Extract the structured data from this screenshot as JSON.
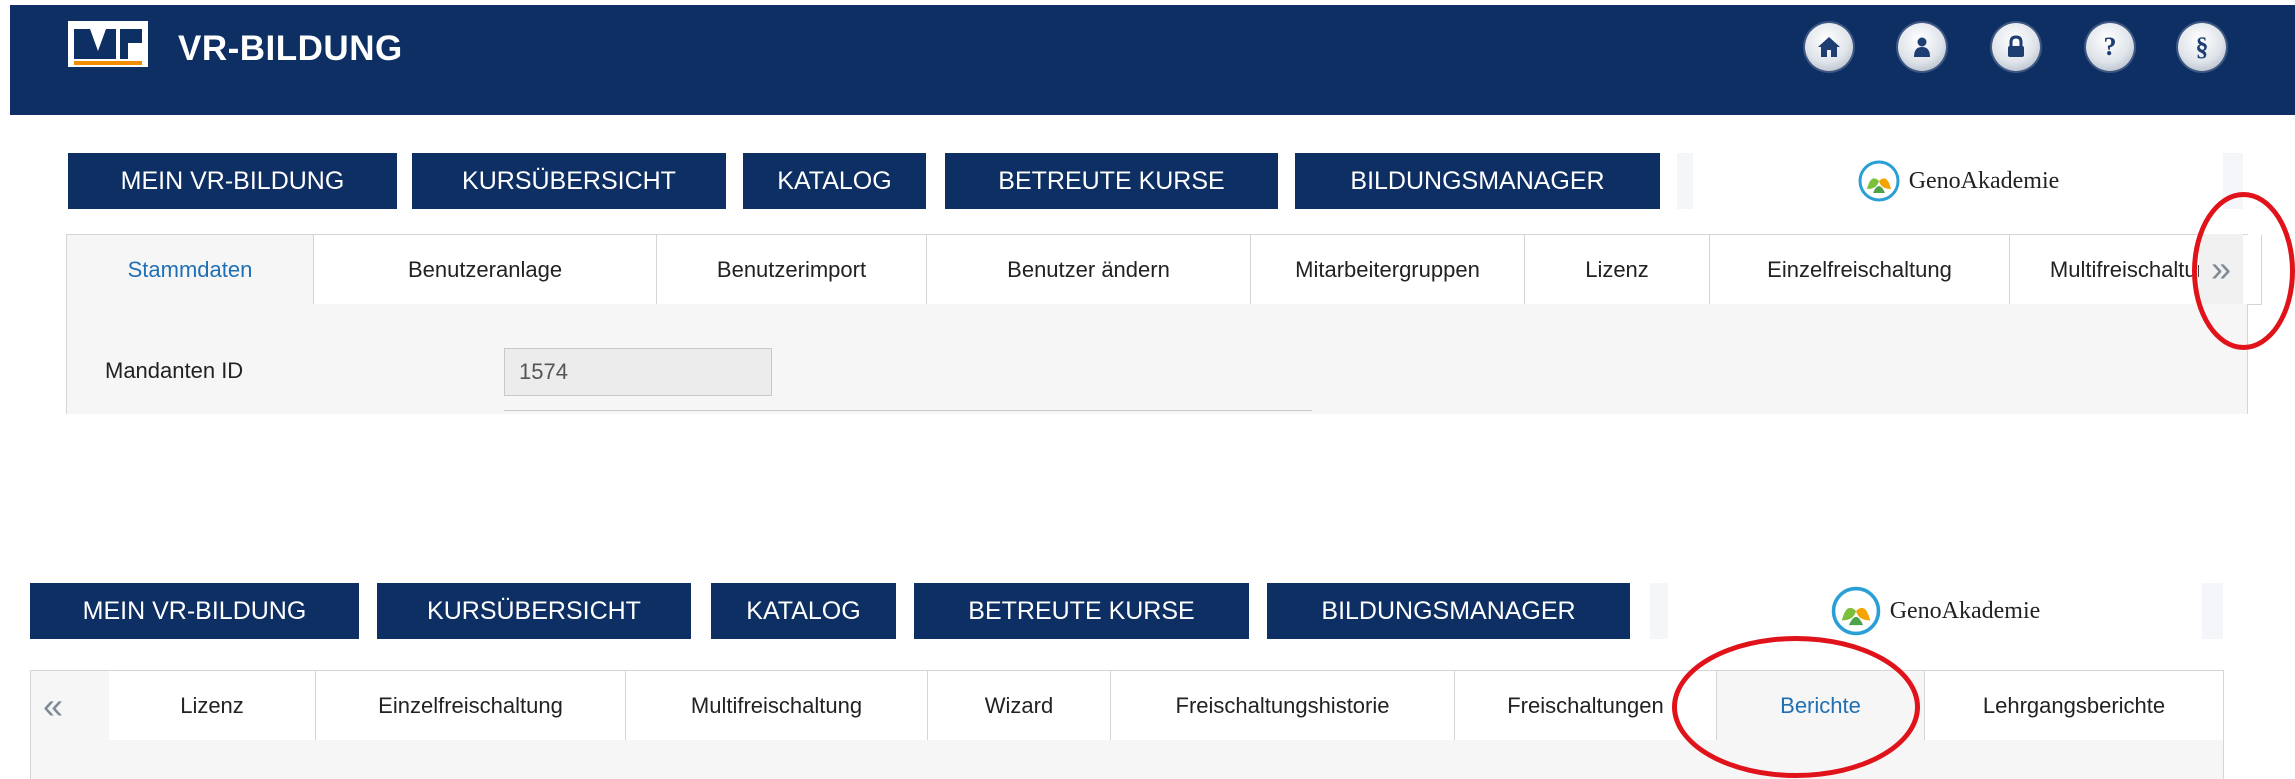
{
  "app": {
    "brand": "VR-BILDUNG",
    "header_icons": [
      "home-icon",
      "user-icon",
      "lock-icon",
      "help-icon",
      "paragraph-icon"
    ],
    "paragraph_glyph": "§",
    "help_glyph": "?",
    "colors": {
      "navy": "#0e2f63",
      "active_tab": "#1f6fb4",
      "highlight": "#e0131b"
    }
  },
  "top": {
    "menu": [
      "MEIN VR-BILDUNG",
      "KURSÜBERSICHT",
      "KATALOG",
      "BETREUTE KURSE",
      "BILDUNGSMANAGER"
    ],
    "partner": "GenoAkademie",
    "tabs": [
      "Stammdaten",
      "Benutzeranlage",
      "Benutzerimport",
      "Benutzer ändern",
      "Mitarbeitergruppen",
      "Lizenz",
      "Einzelfreischaltung",
      "Multifreischaltung"
    ],
    "active_tab": "Stammdaten",
    "next_arrow": "»",
    "field": {
      "label": "Mandanten ID",
      "value": "1574"
    }
  },
  "bottom": {
    "menu": [
      "MEIN VR-BILDUNG",
      "KURSÜBERSICHT",
      "KATALOG",
      "BETREUTE KURSE",
      "BILDUNGSMANAGER"
    ],
    "partner": "GenoAkademie",
    "prev_arrow": "«",
    "tabs": [
      "Lizenz",
      "Einzelfreischaltung",
      "Multifreischaltung",
      "Wizard",
      "Freischaltungshistorie",
      "Freischaltungen",
      "Berichte",
      "Lehrgangsberichte"
    ],
    "active_tab": "Berichte"
  }
}
